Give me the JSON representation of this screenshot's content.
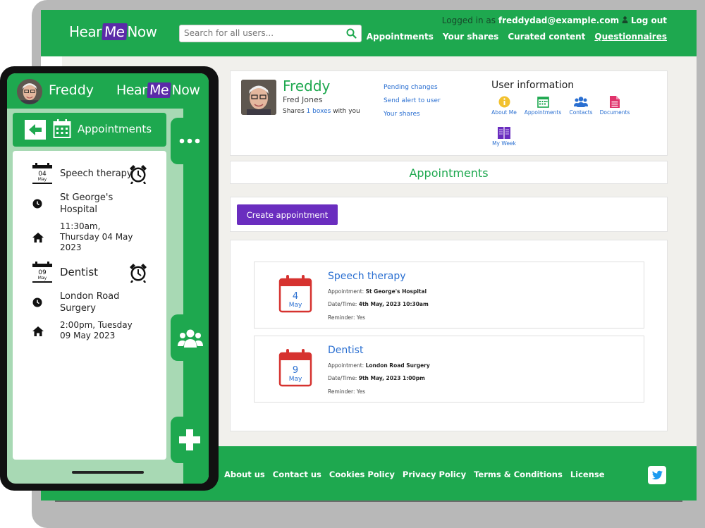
{
  "brand": {
    "hear": "Hear",
    "me": "Me",
    "now": "Now"
  },
  "header": {
    "search_placeholder": "Search for all users...",
    "logged_prefix": "Logged in as",
    "user_email": "freddydad@example.com",
    "logout": "Log out",
    "nav": [
      "Appointments",
      "Your shares",
      "Curated content",
      "Questionnaires"
    ],
    "active_nav": "Questionnaires"
  },
  "profile": {
    "name": "Freddy",
    "full_name": "Fred Jones",
    "shares_prefix": "Shares",
    "shares_link": "1 boxes",
    "shares_suffix": "with you",
    "links": [
      "Pending changes",
      "Send alert to user",
      "Your shares"
    ],
    "user_info_title": "User information",
    "user_info_items": [
      "About Me",
      "Appointments",
      "Contacts",
      "Documents",
      "My Week"
    ]
  },
  "section_title": "Appointments",
  "create_button": "Create appointment",
  "appointments": [
    {
      "title": "Speech therapy",
      "day": "4",
      "month": "May",
      "label_appt": "Appointment:",
      "place": "St George's Hospital",
      "label_dt": "Date/Time:",
      "datetime": "4th May, 2023 10:30am",
      "reminder": "Reminder: Yes"
    },
    {
      "title": "Dentist",
      "day": "9",
      "month": "May",
      "label_appt": "Appointment:",
      "place": "London Road Surgery",
      "label_dt": "Date/Time:",
      "datetime": "9th May, 2023 1:00pm",
      "reminder": "Reminder: Yes"
    }
  ],
  "footer": {
    "links": [
      "About us",
      "Contact us",
      "Cookies Policy",
      "Privacy Policy",
      "Terms & Conditions",
      "License"
    ]
  },
  "phone": {
    "name": "Freddy",
    "title": "Appointments",
    "items": [
      {
        "day": "04",
        "month": "May",
        "title": "Speech therapy",
        "place_l1": "St George's",
        "place_l2": "Hospital",
        "time_l1": "11:30am,",
        "time_l2": "Thursday 04 May",
        "time_l3": "2023"
      },
      {
        "day": "09",
        "month": "May",
        "title": "Dentist",
        "place_l1": "London Road",
        "place_l2": "Surgery",
        "time_l1": "2:00pm, Tuesday",
        "time_l2": "09 May 2023"
      }
    ]
  },
  "colors": {
    "brand_green": "#1ea84f",
    "brand_purple": "#6a2dbf",
    "link_blue": "#2a6fd1",
    "calendar_red": "#d6322f"
  },
  "icons": [
    "search-icon",
    "user-icon",
    "info-icon",
    "calendar-icon",
    "contacts-icon",
    "documents-icon",
    "my-week-icon",
    "back-arrow-icon",
    "alarm-clock-icon",
    "clock-icon",
    "home-icon",
    "more-icon",
    "people-icon",
    "plus-icon",
    "twitter-icon"
  ]
}
